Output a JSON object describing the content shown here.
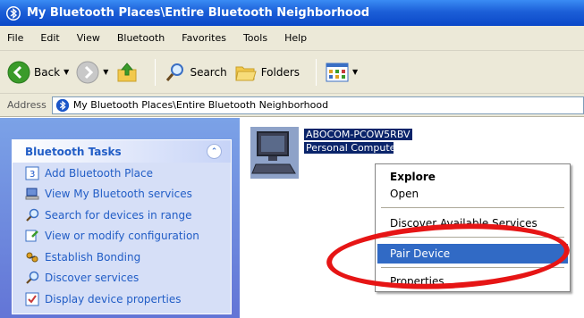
{
  "window": {
    "title": "My Bluetooth Places\\Entire Bluetooth Neighborhood"
  },
  "menubar": {
    "items": [
      "File",
      "Edit",
      "View",
      "Bluetooth",
      "Favorites",
      "Tools",
      "Help"
    ]
  },
  "toolbar": {
    "back_label": "Back",
    "search_label": "Search",
    "folders_label": "Folders"
  },
  "address": {
    "label": "Address",
    "value": "My Bluetooth Places\\Entire Bluetooth Neighborhood"
  },
  "tasks": {
    "title": "Bluetooth Tasks",
    "items": [
      {
        "label": "Add Bluetooth Place",
        "icon": "add-place-icon"
      },
      {
        "label": "View My Bluetooth services",
        "icon": "services-icon"
      },
      {
        "label": "Search for devices in range",
        "icon": "search-icon"
      },
      {
        "label": "View or modify configuration",
        "icon": "config-icon"
      },
      {
        "label": "Establish Bonding",
        "icon": "bonding-icon"
      },
      {
        "label": "Discover services",
        "icon": "search-icon"
      },
      {
        "label": "Display device properties",
        "icon": "properties-icon"
      }
    ]
  },
  "device": {
    "name": "ABOCOM-PCOW5RBV",
    "type": "Personal Computer"
  },
  "context_menu": {
    "explore": "Explore",
    "open": "Open",
    "discover": "Discover Available Services",
    "pair": "Pair Device",
    "properties": "Properties"
  },
  "colors": {
    "title_blue": "#0a48c8",
    "task_link": "#215dc6",
    "selection": "#316ac5",
    "annotation_red": "#e61515"
  }
}
